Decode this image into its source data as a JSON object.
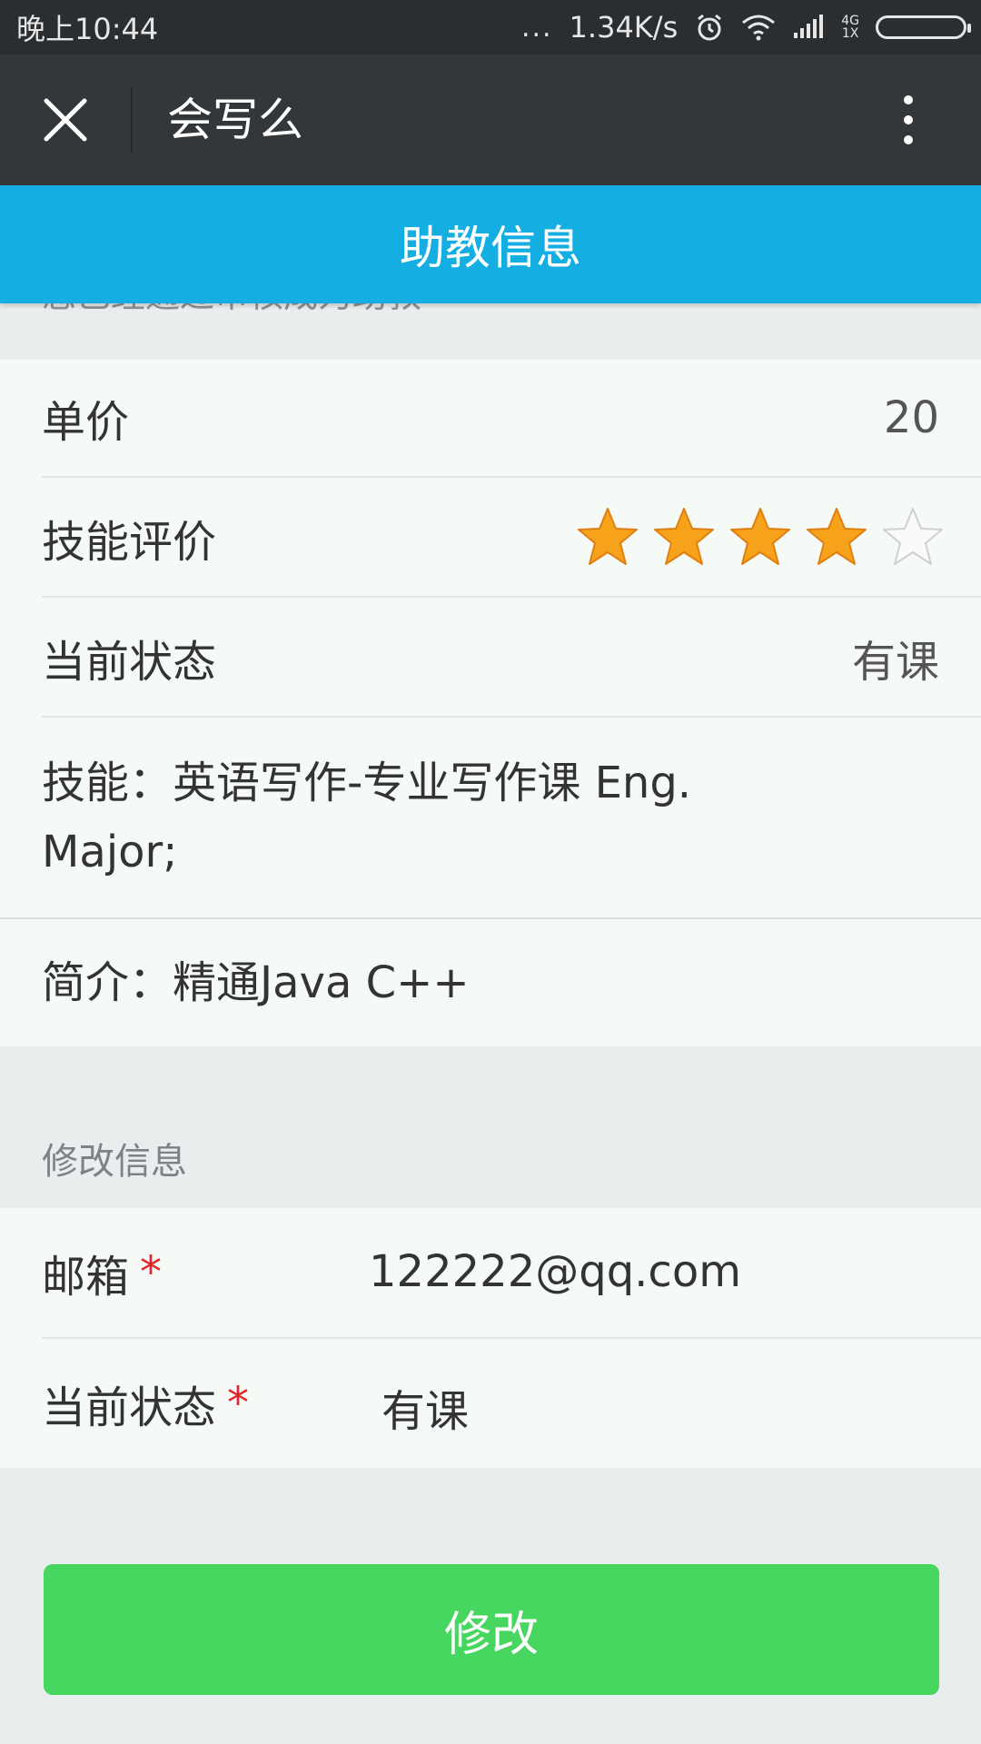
{
  "status_bar": {
    "time": "晚上10:44",
    "dots": "...",
    "speed": "1.34K/s",
    "network_top": "4G",
    "network_bottom": "1X"
  },
  "title_bar": {
    "title": "会写么"
  },
  "page_header": {
    "title": "助教信息"
  },
  "notice": "您已经通过审核成为助教",
  "info": {
    "price_label": "单价",
    "price_value": "20",
    "rating_label": "技能评价",
    "rating_filled": 4,
    "rating_max": 5,
    "status_label": "当前状态",
    "status_value": "有课",
    "skills_text": "技能：英语写作-专业写作课 Eng. Major;",
    "intro_text": "简介：精通Java C++"
  },
  "edit_section": {
    "title": "修改信息",
    "email_label": "邮箱",
    "email_required": "*",
    "email_value": "122222@qq.com",
    "status_label": "当前状态",
    "status_required": "*",
    "status_value": "有课",
    "submit_label": "修改"
  },
  "colors": {
    "header_blue": "#14aee3",
    "button_green": "#47d65f",
    "required_red": "#e1262a",
    "star_orange": "#f7a21b"
  }
}
